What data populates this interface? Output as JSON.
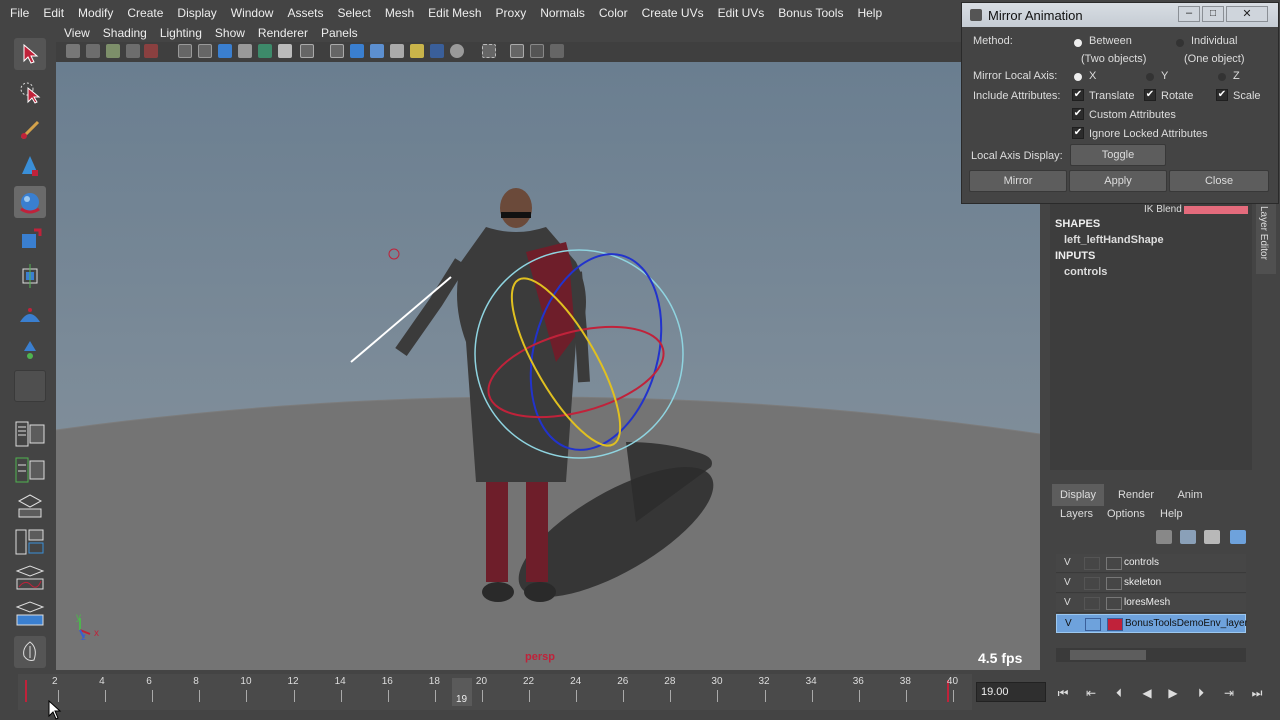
{
  "menubar": {
    "items": [
      "File",
      "Edit",
      "Modify",
      "Create",
      "Display",
      "Window",
      "Assets",
      "Select",
      "Mesh",
      "Edit Mesh",
      "Proxy",
      "Normals",
      "Color",
      "Create UVs",
      "Edit UVs",
      "Bonus Tools",
      "Help"
    ]
  },
  "viewport": {
    "menu": [
      "View",
      "Shading",
      "Lighting",
      "Show",
      "Renderer",
      "Panels"
    ],
    "camera_label": "persp",
    "fps": "4.5 fps",
    "axis_x": "x",
    "axis_y": "y",
    "axis_z": "z"
  },
  "timeline": {
    "ticks": [
      "2",
      "4",
      "6",
      "8",
      "10",
      "12",
      "14",
      "16",
      "18",
      "20",
      "22",
      "24",
      "26",
      "28",
      "30",
      "32",
      "34",
      "36",
      "38",
      "40"
    ],
    "current_frame": "19",
    "time_field": "19.00"
  },
  "playback": {
    "icons": [
      "go-to-start-icon",
      "step-back-key-icon",
      "step-back-frame-icon",
      "play-backward-icon",
      "play-forward-icon",
      "step-forward-frame-icon",
      "step-forward-key-icon",
      "go-to-end-icon"
    ],
    "glyphs": [
      "⏮",
      "⇤",
      "⏴",
      "◀",
      "▶",
      "⏵",
      "⇥",
      "⏭"
    ]
  },
  "dialog": {
    "title": "Mirror Animation",
    "method_label": "Method:",
    "method_between": "Between",
    "method_between_sub": "(Two objects)",
    "method_individual": "Individual",
    "method_individual_sub": "(One object)",
    "axis_label": "Mirror Local Axis:",
    "axis_x": "X",
    "axis_y": "Y",
    "axis_z": "Z",
    "include_label": "Include Attributes:",
    "translate": "Translate",
    "rotate": "Rotate",
    "scale": "Scale",
    "custom": "Custom Attributes",
    "ignore_locked": "Ignore Locked Attributes",
    "local_axis_label": "Local Axis Display:",
    "toggle": "Toggle",
    "mirror": "Mirror",
    "apply": "Apply",
    "close": "Close"
  },
  "channel_box": {
    "partial_attr": "IK Blend",
    "shapes_header": "SHAPES",
    "shape_item": "left_leftHandShape",
    "inputs_header": "INPUTS",
    "input_item": "controls",
    "side_tab": "Layer Editor"
  },
  "layers": {
    "tabs": [
      "Display",
      "Render",
      "Anim"
    ],
    "menu": [
      "Layers",
      "Options",
      "Help"
    ],
    "rows": [
      {
        "v": "V",
        "name": "controls"
      },
      {
        "v": "V",
        "name": "skeleton"
      },
      {
        "v": "V",
        "name": "loresMesh"
      },
      {
        "v": "V",
        "name": "BonusToolsDemoEnv_layer"
      }
    ]
  },
  "colors": {
    "accent_red": "#c0223a",
    "selection_blue": "#6ea2dc"
  }
}
